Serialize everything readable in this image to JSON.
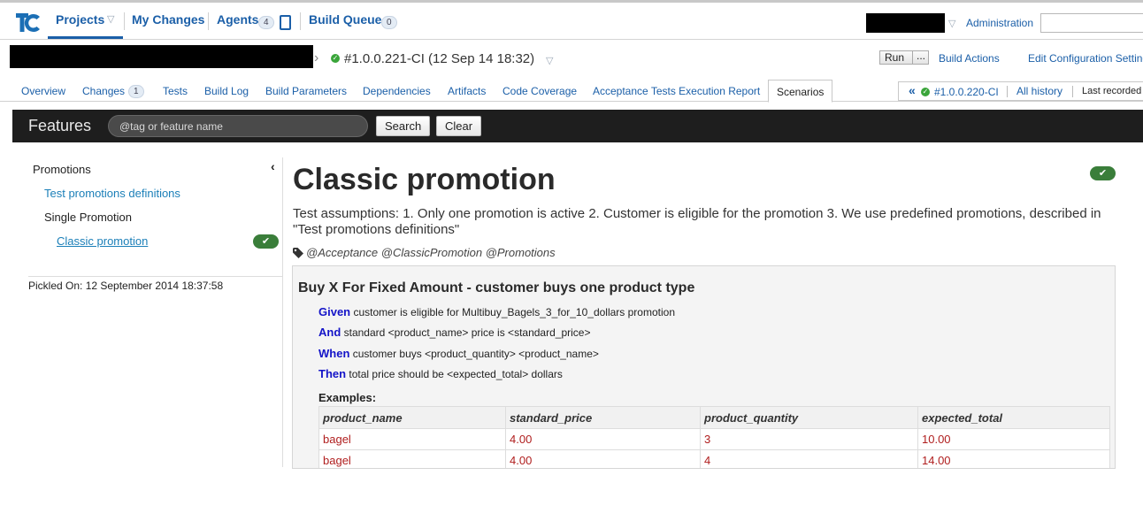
{
  "topnav": {
    "projects": "Projects",
    "my_changes": "My Changes",
    "agents": "Agents",
    "agents_count": "4",
    "build_queue": "Build Queue",
    "build_queue_count": "0",
    "administration": "Administration"
  },
  "build": {
    "number_label": "#1.0.0.221-CI (12 Sep 14 18:32)",
    "run_label": "Run",
    "run_more": "...",
    "build_actions": "Build Actions",
    "edit_config": "Edit Configuration Settings"
  },
  "tabs": {
    "overview": "Overview",
    "changes": "Changes",
    "changes_count": "1",
    "tests": "Tests",
    "build_log": "Build Log",
    "build_parameters": "Build Parameters",
    "dependencies": "Dependencies",
    "artifacts": "Artifacts",
    "code_coverage": "Code Coverage",
    "acceptance_report": "Acceptance Tests Execution Report",
    "scenarios": "Scenarios"
  },
  "history": {
    "prev_icon": "«",
    "prev_build": "#1.0.0.220-CI",
    "all_history": "All history",
    "last_recorded": "Last recorded b"
  },
  "features_bar": {
    "title": "Features",
    "search_placeholder": "@tag or feature name",
    "search_button": "Search",
    "clear_button": "Clear"
  },
  "sidebar": {
    "collapse_icon": "‹",
    "items": [
      {
        "label": "Promotions"
      },
      {
        "label": "Test promotions definitions"
      },
      {
        "label": "Single Promotion"
      },
      {
        "label": "Classic promotion"
      }
    ],
    "pass_icon": "✔",
    "pickled": "Pickled On: 12 September 2014 18:37:58"
  },
  "feature": {
    "title": "Classic promotion",
    "description": "Test assumptions: 1. Only one promotion is active 2. Customer is eligible for the promotion 3. We use predefined promotions, described in \"Test promotions definitions\"",
    "tags": "@Acceptance @ClassicPromotion @Promotions",
    "pass_icon": "✔"
  },
  "scenario": {
    "title": "Buy X For Fixed Amount - customer buys one product type",
    "steps": [
      {
        "keyword": "Given",
        "text": " customer is eligible for Multibuy_Bagels_3_for_10_dollars promotion"
      },
      {
        "keyword": "And",
        "text": " standard <product_name> price is <standard_price>"
      },
      {
        "keyword": "When",
        "text": " customer buys <product_quantity> <product_name>"
      },
      {
        "keyword": "Then",
        "text": " total price should be <expected_total> dollars"
      }
    ],
    "examples_label": "Examples:",
    "examples": {
      "headers": [
        "product_name",
        "standard_price",
        "product_quantity",
        "expected_total"
      ],
      "rows": [
        [
          "bagel",
          "4.00",
          "3",
          "10.00"
        ],
        [
          "bagel",
          "4.00",
          "4",
          "14.00"
        ]
      ]
    }
  },
  "colors": {
    "link": "#1b5fa8",
    "features_bar_bg": "#1e1e1e",
    "pass_green": "#3a7e3a",
    "keyword_blue": "#1414c8",
    "example_value_red": "#b01e1e"
  },
  "icons": {
    "logo": "teamcity-logo",
    "success": "success-dot-icon",
    "tag": "tag-icon"
  }
}
